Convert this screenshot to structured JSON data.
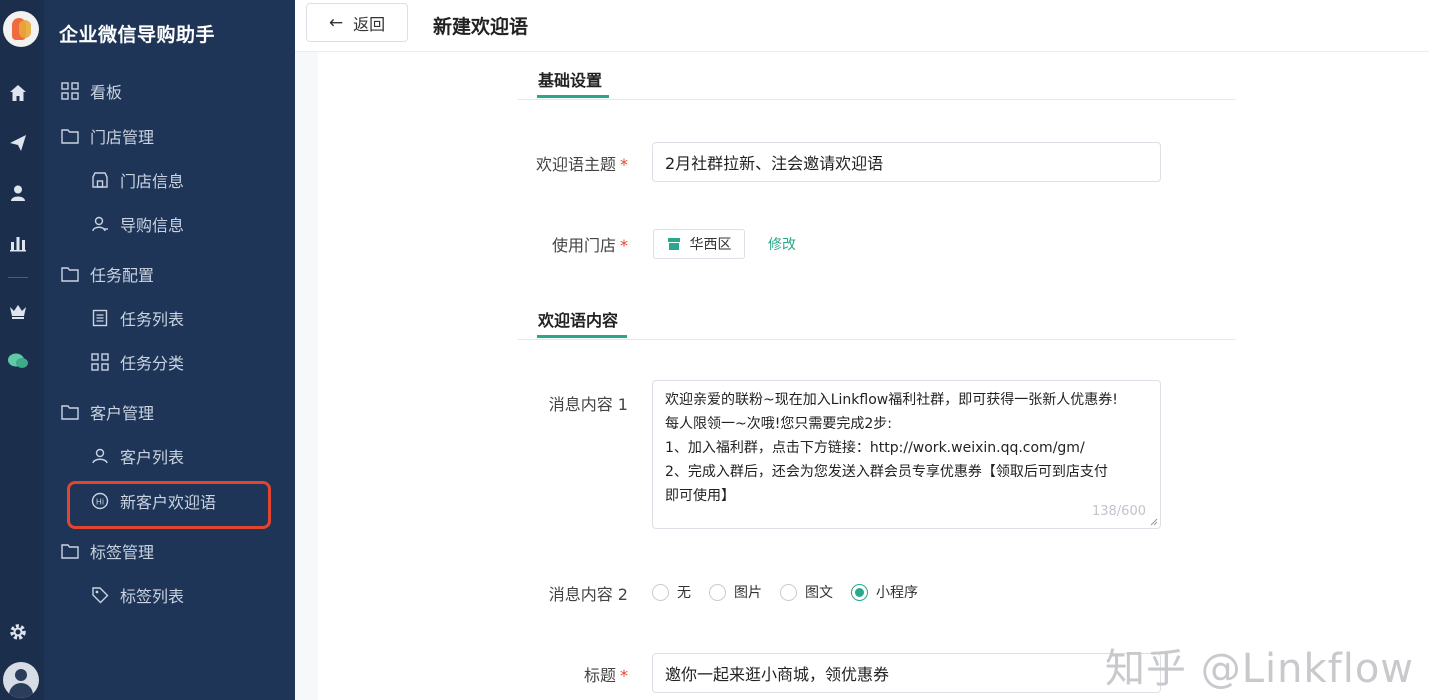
{
  "app": {
    "title": "企业微信导购助手"
  },
  "rail": {
    "icons": [
      "home-icon",
      "send-icon",
      "user-icon",
      "bar-chart-icon",
      "crown-icon",
      "chat-icon",
      "settings-icon"
    ]
  },
  "menu": {
    "dashboard": "看板",
    "store_mgmt": "门店管理",
    "store_info": "门店信息",
    "guide_info": "导购信息",
    "task_config": "任务配置",
    "task_list": "任务列表",
    "task_category": "任务分类",
    "customer_mgmt": "客户管理",
    "customer_list": "客户列表",
    "welcome_msg": "新客户欢迎语",
    "tag_mgmt": "标签管理",
    "tag_list": "标签列表"
  },
  "header": {
    "back_label": "返回",
    "title": "新建欢迎语"
  },
  "form": {
    "section_basic": "基础设置",
    "theme_label": "欢迎语主题",
    "theme_value": "2月社群拉新、注会邀请欢迎语",
    "store_label": "使用门店",
    "store_tag": "华西区",
    "edit_label": "修改",
    "section_content": "欢迎语内容",
    "msg1_label": "消息内容 1",
    "msg1_lines": [
      "欢迎亲爱的联粉~现在加入Linkflow福利社群，即可获得一张新人优惠券!",
      "每人限领一~次哦!您只需要完成2步:",
      "1、加入福利群，点击下方链接：http://work.weixin.qq.com/gm/",
      "2、完成入群后，还会为您发送入群会员专享优惠券【领取后可到店支付",
      "即可使用】"
    ],
    "msg1_counter": "138/600",
    "msg2_label": "消息内容 2",
    "msg2_options": [
      "无",
      "图片",
      "图文",
      "小程序"
    ],
    "msg2_selected": "小程序",
    "title_label": "标题",
    "title_value": "邀你一起来逛小商城，领优惠券"
  },
  "watermark": "知乎 @Linkflow",
  "colors": {
    "sidebar": "#1e3557",
    "rail": "#1b2f4c",
    "accent": "#2aa88e",
    "required": "#e2452f",
    "highlight": "#e2452f"
  }
}
